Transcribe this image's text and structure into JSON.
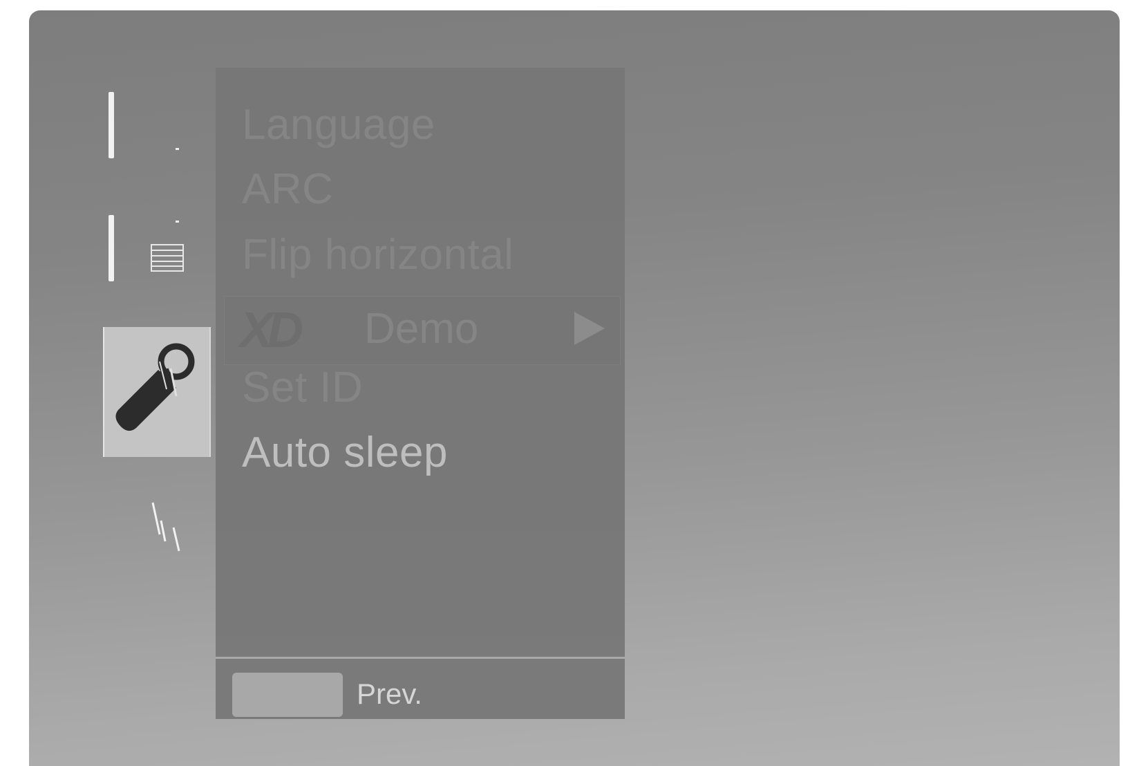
{
  "sidebar": {
    "icons": [
      {
        "name": "picture-tab-icon"
      },
      {
        "name": "option-menu-icon"
      },
      {
        "name": "tool-icon",
        "selected": true
      },
      {
        "name": "audio-tab-icon"
      }
    ]
  },
  "menu": {
    "items": [
      {
        "label": "Language"
      },
      {
        "label": "ARC"
      },
      {
        "label": "Flip horizontal"
      },
      {
        "label": "Demo",
        "logo": "XD",
        "has_submenu": true,
        "highlighted": true
      },
      {
        "label": "Set ID"
      },
      {
        "label": "Auto sleep"
      }
    ]
  },
  "footer": {
    "prev_label": "Prev."
  },
  "colors": {
    "screen_top": "#7d7d7d",
    "screen_bottom": "#b2b2b2",
    "panel": "#777777",
    "dim_text": "#858585",
    "bright_text": "#bebebe"
  }
}
